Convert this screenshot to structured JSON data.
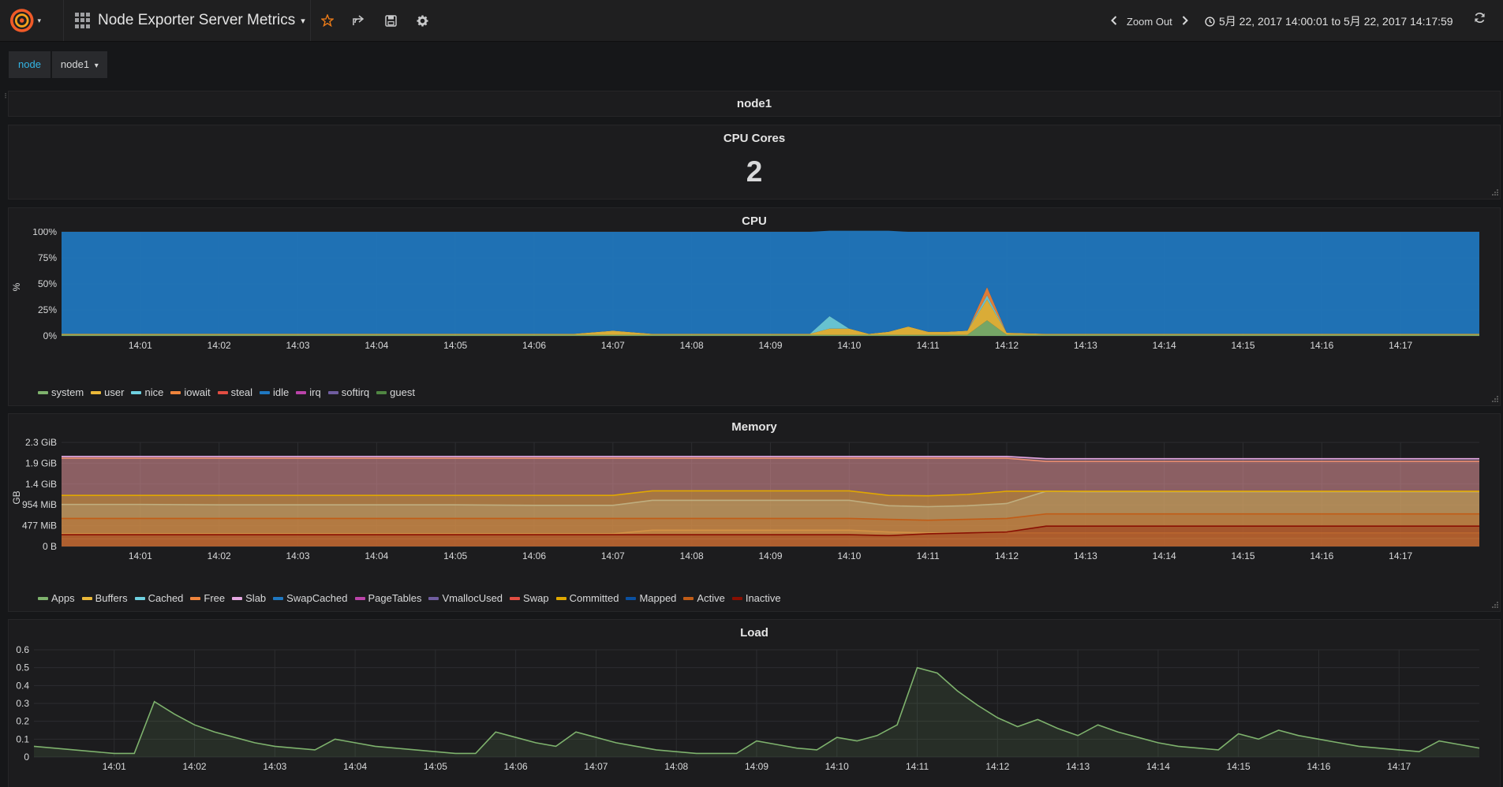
{
  "nav": {
    "title": "Node Exporter Server Metrics",
    "zoom_out": "Zoom Out",
    "time_range": "5月 22, 2017 14:00:01 to 5月 22, 2017 14:17:59"
  },
  "variables": {
    "label": "node",
    "value": "node1"
  },
  "row": {
    "title": "node1"
  },
  "panels": {
    "cpu_cores": {
      "title": "CPU Cores",
      "value": "2"
    },
    "cpu": {
      "title": "CPU",
      "ylabel": "%"
    },
    "memory": {
      "title": "Memory",
      "ylabel": "GB"
    },
    "load": {
      "title": "Load"
    }
  },
  "chart_data": [
    {
      "id": "cpu",
      "type": "area",
      "title": "CPU",
      "ylabel": "%",
      "ylim": [
        0,
        100
      ],
      "yticks": [
        "0%",
        "25%",
        "50%",
        "75%",
        "100%"
      ],
      "xticks": [
        "14:01",
        "14:02",
        "14:03",
        "14:04",
        "14:05",
        "14:06",
        "14:07",
        "14:08",
        "14:09",
        "14:10",
        "14:11",
        "14:12",
        "14:13",
        "14:14",
        "14:15",
        "14:16",
        "14:17"
      ],
      "x": [
        0,
        0.5,
        1,
        1.5,
        2,
        2.5,
        3,
        3.5,
        4,
        4.5,
        5,
        5.5,
        6,
        6.5,
        7,
        7.5,
        8,
        8.5,
        9,
        9.25,
        9.5,
        9.75,
        10,
        10.25,
        10.5,
        10.75,
        11,
        11.25,
        11.5,
        11.75,
        12,
        12.5,
        13,
        13.5,
        14,
        14.5,
        15,
        15.5,
        16,
        16.5,
        17,
        17.5,
        18
      ],
      "stacked": true,
      "legend_position": "bottom-left",
      "grid": true,
      "series": [
        {
          "name": "system",
          "color": "#7eb26d",
          "values": [
            1,
            1,
            1,
            1,
            1,
            1,
            1,
            1,
            1,
            1,
            1,
            1,
            1,
            1,
            1,
            1,
            1,
            1,
            1,
            1,
            1,
            1,
            1,
            1,
            1,
            1,
            1,
            1,
            1,
            15,
            1,
            1,
            1,
            1,
            1,
            1,
            1,
            1,
            1,
            1,
            1,
            1,
            1
          ]
        },
        {
          "name": "user",
          "color": "#eab839",
          "values": [
            1,
            1,
            1,
            1,
            1,
            1,
            1,
            1,
            1,
            1,
            1,
            1,
            1,
            1,
            4,
            1,
            1,
            1,
            1,
            1,
            1,
            6,
            6,
            1,
            3,
            8,
            3,
            3,
            4,
            20,
            2,
            1,
            1,
            1,
            1,
            1,
            1,
            1,
            1,
            1,
            1,
            1,
            1
          ]
        },
        {
          "name": "nice",
          "color": "#6ed0e0",
          "values": [
            0,
            0,
            0,
            0,
            0,
            0,
            0,
            0,
            0,
            0,
            0,
            0,
            0,
            0,
            0,
            0,
            0,
            0,
            0,
            0,
            0,
            12,
            0,
            0,
            0,
            0,
            0,
            0,
            0,
            4,
            0,
            0,
            0,
            0,
            0,
            0,
            0,
            0,
            0,
            0,
            0,
            0,
            0
          ]
        },
        {
          "name": "iowait",
          "color": "#ef843c",
          "values": [
            0,
            0,
            0,
            0,
            0,
            0,
            0,
            0,
            0,
            0,
            0,
            0,
            0,
            0,
            0,
            0,
            0,
            0,
            0,
            0,
            0,
            0,
            0,
            0,
            0,
            0,
            0,
            0,
            0,
            8,
            0,
            0,
            0,
            0,
            0,
            0,
            0,
            0,
            0,
            0,
            0,
            0,
            0
          ]
        },
        {
          "name": "steal",
          "color": "#e24d42",
          "values": [
            0,
            0,
            0,
            0,
            0,
            0,
            0,
            0,
            0,
            0,
            0,
            0,
            0,
            0,
            0,
            0,
            0,
            0,
            0,
            0,
            0,
            0,
            0,
            0,
            0,
            0,
            0,
            0,
            0,
            0,
            0,
            0,
            0,
            0,
            0,
            0,
            0,
            0,
            0,
            0,
            0,
            0,
            0
          ]
        },
        {
          "name": "idle",
          "color": "#1f78c1",
          "values": [
            98,
            98,
            98,
            98,
            98,
            98,
            98,
            98,
            98,
            98,
            98,
            98,
            98,
            98,
            95,
            98,
            98,
            98,
            98,
            98,
            98,
            82,
            94,
            99,
            97,
            91,
            96,
            96,
            95,
            53,
            97,
            98,
            98,
            98,
            98,
            98,
            98,
            98,
            98,
            98,
            98,
            98,
            98
          ]
        },
        {
          "name": "irq",
          "color": "#ba43a9",
          "values": [
            0,
            0,
            0,
            0,
            0,
            0,
            0,
            0,
            0,
            0,
            0,
            0,
            0,
            0,
            0,
            0,
            0,
            0,
            0,
            0,
            0,
            0,
            0,
            0,
            0,
            0,
            0,
            0,
            0,
            0,
            0,
            0,
            0,
            0,
            0,
            0,
            0,
            0,
            0,
            0,
            0,
            0,
            0
          ]
        },
        {
          "name": "softirq",
          "color": "#705da0",
          "values": [
            0,
            0,
            0,
            0,
            0,
            0,
            0,
            0,
            0,
            0,
            0,
            0,
            0,
            0,
            0,
            0,
            0,
            0,
            0,
            0,
            0,
            0,
            0,
            0,
            0,
            0,
            0,
            0,
            0,
            0,
            0,
            0,
            0,
            0,
            0,
            0,
            0,
            0,
            0,
            0,
            0,
            0,
            0
          ]
        },
        {
          "name": "guest",
          "color": "#508642",
          "values": [
            0,
            0,
            0,
            0,
            0,
            0,
            0,
            0,
            0,
            0,
            0,
            0,
            0,
            0,
            0,
            0,
            0,
            0,
            0,
            0,
            0,
            0,
            0,
            0,
            0,
            0,
            0,
            0,
            0,
            0,
            0,
            0,
            0,
            0,
            0,
            0,
            0,
            0,
            0,
            0,
            0,
            0,
            0
          ]
        }
      ]
    },
    {
      "id": "memory",
      "type": "area",
      "title": "Memory",
      "ylabel": "GB",
      "ylim": [
        0,
        2.3
      ],
      "yticks": [
        "0 B",
        "477 MiB",
        "954 MiB",
        "1.4 GiB",
        "1.9 GiB",
        "2.3 GiB"
      ],
      "xticks": [
        "14:01",
        "14:02",
        "14:03",
        "14:04",
        "14:05",
        "14:06",
        "14:07",
        "14:08",
        "14:09",
        "14:10",
        "14:11",
        "14:12",
        "14:13",
        "14:14",
        "14:15",
        "14:16",
        "14:17"
      ],
      "x": [
        0,
        1,
        2,
        3,
        4,
        5,
        6,
        7,
        7.5,
        8,
        9,
        10,
        10.5,
        11,
        11.5,
        12,
        12.5,
        13,
        14,
        15,
        16,
        17,
        18
      ],
      "legend_position": "bottom-left",
      "grid": true,
      "series": [
        {
          "name": "Apps",
          "color": "#7eb26d",
          "values": [
            0.17,
            0.17,
            0.17,
            0.17,
            0.17,
            0.17,
            0.17,
            0.17,
            0.17,
            0.17,
            0.17,
            0.17,
            0.17,
            0.17,
            0.17,
            0.18,
            0.18,
            0.18,
            0.18,
            0.18,
            0.18,
            0.18,
            0.18
          ]
        },
        {
          "name": "Buffers",
          "color": "#eab839",
          "values": [
            0.28,
            0.28,
            0.28,
            0.28,
            0.28,
            0.28,
            0.28,
            0.28,
            0.36,
            0.36,
            0.36,
            0.36,
            0.32,
            0.3,
            0.3,
            0.3,
            0.3,
            0.3,
            0.3,
            0.3,
            0.3,
            0.3,
            0.3
          ]
        },
        {
          "name": "Cached",
          "color": "#6ed0e0",
          "values": [
            0.93,
            0.93,
            0.92,
            0.92,
            0.92,
            0.92,
            0.91,
            0.91,
            1.02,
            1.02,
            1.02,
            1.02,
            0.9,
            0.88,
            0.9,
            0.95,
            1.22,
            1.21,
            1.21,
            1.21,
            1.21,
            1.21,
            1.21
          ]
        },
        {
          "name": "Free",
          "color": "#ef843c",
          "values": [
            1.95,
            1.95,
            1.95,
            1.95,
            1.95,
            1.95,
            1.95,
            1.95,
            1.95,
            1.95,
            1.95,
            1.95,
            1.95,
            1.95,
            1.95,
            1.95,
            1.88,
            1.88,
            1.88,
            1.88,
            1.88,
            1.88,
            1.88
          ]
        },
        {
          "name": "Slab",
          "color": "#e5a8e2",
          "values": [
            1.99,
            1.99,
            1.99,
            1.99,
            1.99,
            1.99,
            1.99,
            1.99,
            1.99,
            1.99,
            1.99,
            1.99,
            1.99,
            1.99,
            1.99,
            1.99,
            1.94,
            1.94,
            1.94,
            1.94,
            1.94,
            1.94,
            1.94
          ]
        },
        {
          "name": "SwapCached",
          "color": "#1f78c1",
          "values": []
        },
        {
          "name": "PageTables",
          "color": "#ba43a9",
          "values": []
        },
        {
          "name": "VmallocUsed",
          "color": "#705da0",
          "values": []
        },
        {
          "name": "Swap",
          "color": "#e24d42",
          "values": []
        },
        {
          "name": "Committed",
          "color": "#e0a800",
          "values": [
            1.13,
            1.13,
            1.13,
            1.13,
            1.13,
            1.13,
            1.13,
            1.13,
            1.23,
            1.23,
            1.23,
            1.23,
            1.13,
            1.12,
            1.15,
            1.22,
            1.22,
            1.22,
            1.22,
            1.22,
            1.22,
            1.22,
            1.22
          ]
        },
        {
          "name": "Mapped",
          "color": "#0a50a1",
          "values": []
        },
        {
          "name": "Active",
          "color": "#c15c17",
          "values": [
            0.62,
            0.62,
            0.62,
            0.62,
            0.62,
            0.62,
            0.62,
            0.62,
            0.62,
            0.62,
            0.62,
            0.62,
            0.6,
            0.58,
            0.6,
            0.62,
            0.72,
            0.72,
            0.72,
            0.72,
            0.72,
            0.72,
            0.72
          ]
        },
        {
          "name": "Inactive",
          "color": "#890f02",
          "values": [
            0.26,
            0.26,
            0.26,
            0.26,
            0.26,
            0.26,
            0.26,
            0.26,
            0.26,
            0.26,
            0.26,
            0.26,
            0.24,
            0.28,
            0.3,
            0.32,
            0.45,
            0.45,
            0.45,
            0.45,
            0.45,
            0.45,
            0.45
          ]
        }
      ]
    },
    {
      "id": "load",
      "type": "area",
      "title": "Load",
      "ylim": [
        0,
        0.6
      ],
      "yticks": [
        "0",
        "0.1",
        "0.2",
        "0.3",
        "0.4",
        "0.5",
        "0.6"
      ],
      "xticks": [
        "14:01",
        "14:02",
        "14:03",
        "14:04",
        "14:05",
        "14:06",
        "14:07",
        "14:08",
        "14:09",
        "14:10",
        "14:11",
        "14:12",
        "14:13",
        "14:14",
        "14:15",
        "14:16",
        "14:17"
      ],
      "x": [
        0,
        0.25,
        0.5,
        0.75,
        1,
        1.25,
        1.5,
        1.75,
        2,
        2.25,
        2.5,
        2.75,
        3,
        3.25,
        3.5,
        3.75,
        4,
        4.25,
        4.5,
        4.75,
        5,
        5.25,
        5.5,
        5.75,
        6,
        6.25,
        6.5,
        6.75,
        7,
        7.25,
        7.5,
        7.75,
        8,
        8.25,
        8.5,
        8.75,
        9,
        9.25,
        9.5,
        9.75,
        10,
        10.25,
        10.5,
        10.75,
        11,
        11.25,
        11.5,
        11.75,
        12,
        12.25,
        12.5,
        12.75,
        13,
        13.25,
        13.5,
        13.75,
        14,
        14.25,
        14.5,
        14.75,
        15,
        15.25,
        15.5,
        15.75,
        16,
        16.25,
        16.5,
        16.75,
        17,
        17.25,
        17.5,
        17.75,
        18
      ],
      "grid": true,
      "series": [
        {
          "name": "load",
          "color": "#7eb26d",
          "values": [
            0.06,
            0.05,
            0.04,
            0.03,
            0.02,
            0.02,
            0.31,
            0.24,
            0.18,
            0.14,
            0.11,
            0.08,
            0.06,
            0.05,
            0.04,
            0.1,
            0.08,
            0.06,
            0.05,
            0.04,
            0.03,
            0.02,
            0.02,
            0.14,
            0.11,
            0.08,
            0.06,
            0.14,
            0.11,
            0.08,
            0.06,
            0.04,
            0.03,
            0.02,
            0.02,
            0.02,
            0.09,
            0.07,
            0.05,
            0.04,
            0.11,
            0.09,
            0.12,
            0.18,
            0.5,
            0.47,
            0.37,
            0.29,
            0.22,
            0.17,
            0.21,
            0.16,
            0.12,
            0.18,
            0.14,
            0.11,
            0.08,
            0.06,
            0.05,
            0.04,
            0.13,
            0.1,
            0.15,
            0.12,
            0.1,
            0.08,
            0.06,
            0.05,
            0.04,
            0.03,
            0.09,
            0.07,
            0.05
          ]
        }
      ]
    }
  ]
}
